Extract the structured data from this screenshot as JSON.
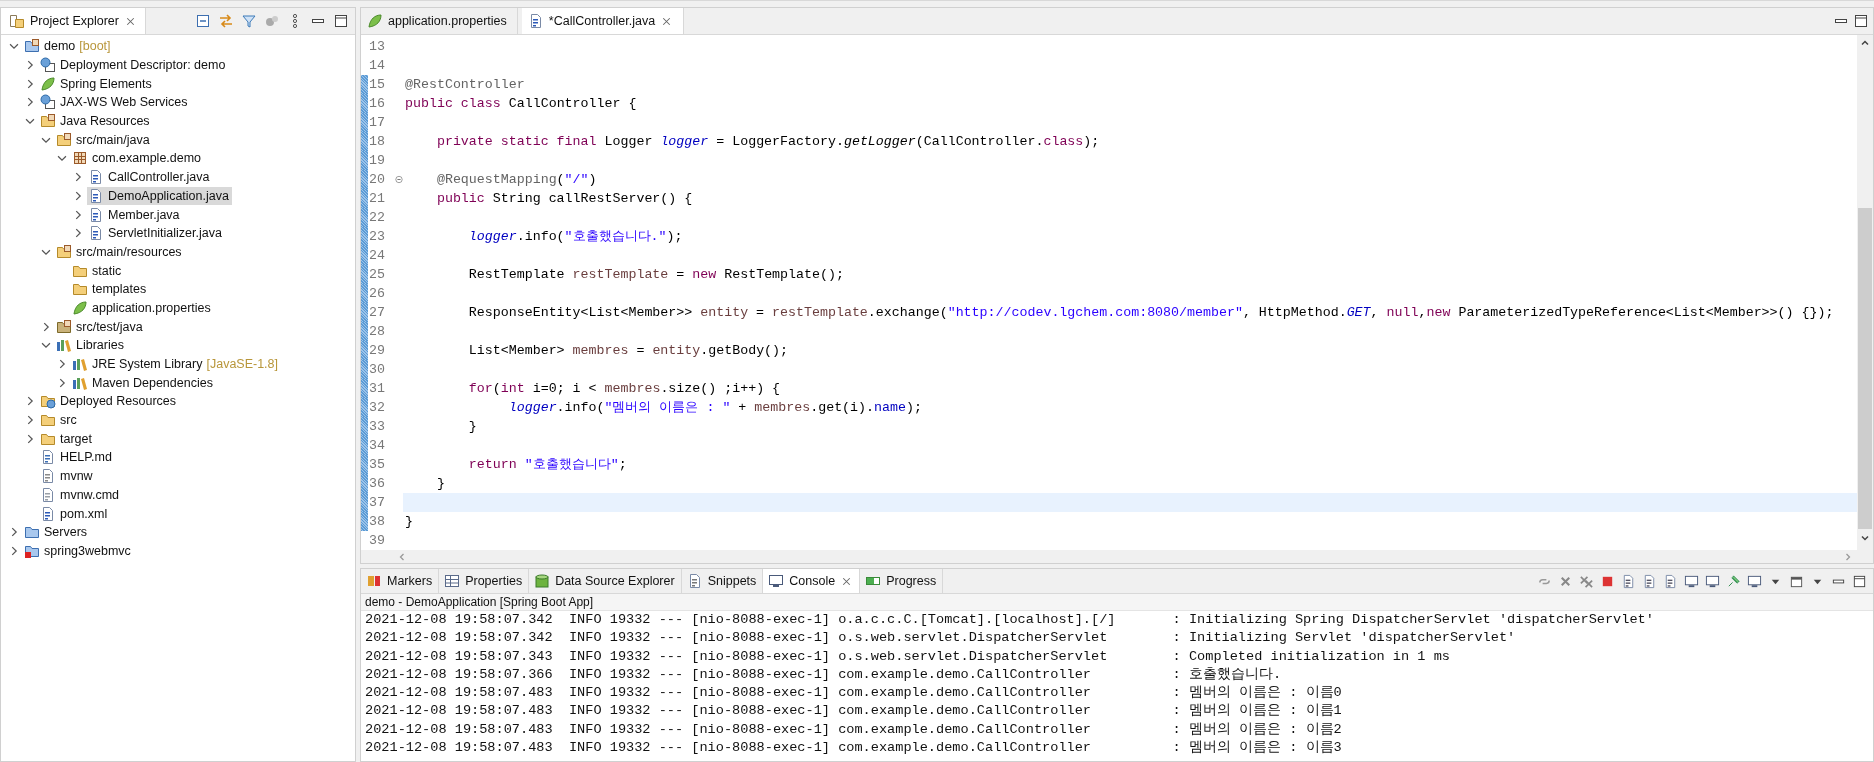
{
  "explorer": {
    "title": "Project Explorer",
    "tree": [
      {
        "label": "demo",
        "decoration": "[boot]",
        "kind": "boot-project",
        "expanded": true,
        "selected": false,
        "children": [
          {
            "label": "Deployment Descriptor: demo",
            "kind": "deployment-descriptor",
            "expanded": false,
            "selected": false
          },
          {
            "label": "Spring Elements",
            "kind": "spring-leaf",
            "expanded": false,
            "selected": false
          },
          {
            "label": "JAX-WS Web Services",
            "kind": "web-services",
            "expanded": false,
            "selected": false
          },
          {
            "label": "Java Resources",
            "kind": "java-resources",
            "expanded": true,
            "selected": false,
            "children": [
              {
                "label": "src/main/java",
                "kind": "source-folder",
                "expanded": true,
                "selected": false,
                "children": [
                  {
                    "label": "com.example.demo",
                    "kind": "package",
                    "expanded": true,
                    "selected": false,
                    "children": [
                      {
                        "label": "CallController.java",
                        "kind": "java-file",
                        "expanded": false,
                        "selected": false
                      },
                      {
                        "label": "DemoApplication.java",
                        "kind": "java-file",
                        "expanded": false,
                        "selected": true
                      },
                      {
                        "label": "Member.java",
                        "kind": "java-file",
                        "expanded": false,
                        "selected": false
                      },
                      {
                        "label": "ServletInitializer.java",
                        "kind": "java-file",
                        "expanded": false,
                        "selected": false
                      }
                    ]
                  }
                ]
              },
              {
                "label": "src/main/resources",
                "kind": "source-folder",
                "expanded": true,
                "selected": false,
                "children": [
                  {
                    "label": "static",
                    "kind": "folder",
                    "selected": false
                  },
                  {
                    "label": "templates",
                    "kind": "folder",
                    "selected": false
                  },
                  {
                    "label": "application.properties",
                    "kind": "spring-leaf",
                    "selected": false
                  }
                ]
              },
              {
                "label": "src/test/java",
                "kind": "test-source-folder",
                "expanded": false,
                "selected": false
              },
              {
                "label": "Libraries",
                "kind": "libraries",
                "expanded": true,
                "selected": false,
                "children": [
                  {
                    "label": "JRE System Library",
                    "decoration": "[JavaSE-1.8]",
                    "kind": "libraries",
                    "expanded": false,
                    "selected": false
                  },
                  {
                    "label": "Maven Dependencies",
                    "kind": "libraries",
                    "expanded": false,
                    "selected": false
                  }
                ]
              }
            ]
          },
          {
            "label": "Deployed Resources",
            "kind": "deployed",
            "expanded": false,
            "selected": false
          },
          {
            "label": "src",
            "kind": "folder",
            "expanded": false,
            "selected": false
          },
          {
            "label": "target",
            "kind": "folder",
            "expanded": false,
            "selected": false
          },
          {
            "label": "HELP.md",
            "kind": "markdown",
            "selected": false
          },
          {
            "label": "mvnw",
            "kind": "text-file",
            "selected": false
          },
          {
            "label": "mvnw.cmd",
            "kind": "cmd-file",
            "selected": false
          },
          {
            "label": "pom.xml",
            "kind": "maven-file",
            "selected": false
          }
        ]
      },
      {
        "label": "Servers",
        "kind": "servers",
        "expanded": false,
        "selected": false
      },
      {
        "label": "spring3webmvc",
        "kind": "error-project",
        "expanded": false,
        "selected": false
      }
    ]
  },
  "editor": {
    "tabs": [
      {
        "label": "application.properties",
        "kind": "spring-leaf",
        "selected": false
      },
      {
        "label": "*CallController.java",
        "kind": "java-file",
        "selected": true
      }
    ],
    "lines": [
      {
        "number": "13",
        "changed": false,
        "current": false,
        "foldable": false
      },
      {
        "number": "14",
        "changed": false,
        "current": false,
        "foldable": false
      },
      {
        "number": "15",
        "changed": true,
        "current": false,
        "foldable": false,
        "tokens": [
          {
            "kind": "annotation",
            "text": "@RestController"
          }
        ]
      },
      {
        "number": "16",
        "changed": true,
        "current": false,
        "foldable": false,
        "tokens": [
          {
            "kind": "keyword",
            "text": "public"
          },
          {
            "kind": "keyword",
            "text": " class"
          },
          {
            "kind": "plain",
            "text": " CallController {"
          }
        ]
      },
      {
        "number": "17",
        "changed": true,
        "current": false,
        "foldable": false
      },
      {
        "number": "18",
        "changed": true,
        "current": false,
        "foldable": false,
        "tokens": [
          {
            "kind": "keyword",
            "text": "    private"
          },
          {
            "kind": "keyword",
            "text": " static"
          },
          {
            "kind": "keyword",
            "text": " final"
          },
          {
            "kind": "plain",
            "text": " Logger "
          },
          {
            "kind": "static-field",
            "text": "logger"
          },
          {
            "kind": "plain",
            "text": " = LoggerFactory."
          },
          {
            "kind": "static-method",
            "text": "getLogger"
          },
          {
            "kind": "plain",
            "text": "(CallController."
          },
          {
            "kind": "keyword",
            "text": "class"
          },
          {
            "kind": "plain",
            "text": ");"
          }
        ]
      },
      {
        "number": "19",
        "changed": true,
        "current": false,
        "foldable": false
      },
      {
        "number": "20",
        "changed": true,
        "current": false,
        "foldable": true,
        "tokens": [
          {
            "kind": "annotation",
            "text": "    @RequestMapping"
          },
          {
            "kind": "plain",
            "text": "("
          },
          {
            "kind": "string",
            "text": "\"/\""
          },
          {
            "kind": "plain",
            "text": ")"
          }
        ]
      },
      {
        "number": "21",
        "changed": true,
        "current": false,
        "foldable": false,
        "tokens": [
          {
            "kind": "keyword",
            "text": "    public"
          },
          {
            "kind": "plain",
            "text": " String callRestServer() {"
          }
        ]
      },
      {
        "number": "22",
        "changed": true,
        "current": false,
        "foldable": false
      },
      {
        "number": "23",
        "changed": true,
        "current": false,
        "foldable": false,
        "tokens": [
          {
            "kind": "static-field",
            "text": "        logger"
          },
          {
            "kind": "plain",
            "text": ".info("
          },
          {
            "kind": "string",
            "text": "\"호출했습니다.\""
          },
          {
            "kind": "plain",
            "text": ");"
          }
        ]
      },
      {
        "number": "24",
        "changed": true,
        "current": false,
        "foldable": false
      },
      {
        "number": "25",
        "changed": true,
        "current": false,
        "foldable": false,
        "tokens": [
          {
            "kind": "plain",
            "text": "        RestTemplate "
          },
          {
            "kind": "local",
            "text": "restTemplate"
          },
          {
            "kind": "plain",
            "text": " = "
          },
          {
            "kind": "keyword",
            "text": "new"
          },
          {
            "kind": "plain",
            "text": " RestTemplate();"
          }
        ]
      },
      {
        "number": "26",
        "changed": true,
        "current": false,
        "foldable": false
      },
      {
        "number": "27",
        "changed": true,
        "current": false,
        "foldable": false,
        "tokens": [
          {
            "kind": "plain",
            "text": "        ResponseEntity<List<Member>> "
          },
          {
            "kind": "local",
            "text": "entity"
          },
          {
            "kind": "plain",
            "text": " = "
          },
          {
            "kind": "local",
            "text": "restTemplate"
          },
          {
            "kind": "plain",
            "text": ".exchange("
          },
          {
            "kind": "string",
            "text": "\"http://codev.lgchem.com:8080/member\""
          },
          {
            "kind": "plain",
            "text": ", HttpMethod."
          },
          {
            "kind": "static-field",
            "text": "GET"
          },
          {
            "kind": "plain",
            "text": ", "
          },
          {
            "kind": "keyword",
            "text": "null"
          },
          {
            "kind": "plain",
            "text": ","
          },
          {
            "kind": "keyword",
            "text": "new"
          },
          {
            "kind": "plain",
            "text": " ParameterizedTypeReference<List<Member>>() {});"
          }
        ]
      },
      {
        "number": "28",
        "changed": true,
        "current": false,
        "foldable": false
      },
      {
        "number": "29",
        "changed": true,
        "current": false,
        "foldable": false,
        "tokens": [
          {
            "kind": "plain",
            "text": "        List<Member> "
          },
          {
            "kind": "local",
            "text": "membres"
          },
          {
            "kind": "plain",
            "text": " = "
          },
          {
            "kind": "local",
            "text": "entity"
          },
          {
            "kind": "plain",
            "text": ".getBody();"
          }
        ]
      },
      {
        "number": "30",
        "changed": true,
        "current": false,
        "foldable": false
      },
      {
        "number": "31",
        "changed": true,
        "current": false,
        "foldable": false,
        "tokens": [
          {
            "kind": "keyword",
            "text": "        for"
          },
          {
            "kind": "plain",
            "text": "("
          },
          {
            "kind": "keyword",
            "text": "int"
          },
          {
            "kind": "plain",
            "text": " i=0; i < "
          },
          {
            "kind": "local",
            "text": "membres"
          },
          {
            "kind": "plain",
            "text": ".size() ;i++) {"
          }
        ]
      },
      {
        "number": "32",
        "changed": true,
        "current": false,
        "foldable": false,
        "tokens": [
          {
            "kind": "static-field",
            "text": "             logger"
          },
          {
            "kind": "plain",
            "text": ".info("
          },
          {
            "kind": "string",
            "text": "\"멤버의 이름은 : \""
          },
          {
            "kind": "plain",
            "text": " + "
          },
          {
            "kind": "local",
            "text": "membres"
          },
          {
            "kind": "plain",
            "text": ".get(i)."
          },
          {
            "kind": "field",
            "text": "name"
          },
          {
            "kind": "plain",
            "text": ");"
          }
        ]
      },
      {
        "number": "33",
        "changed": true,
        "current": false,
        "foldable": false,
        "tokens": [
          {
            "kind": "plain",
            "text": "        }"
          }
        ]
      },
      {
        "number": "34",
        "changed": true,
        "current": false,
        "foldable": false
      },
      {
        "number": "35",
        "changed": true,
        "current": false,
        "foldable": false,
        "tokens": [
          {
            "kind": "keyword",
            "text": "        return"
          },
          {
            "kind": "string",
            "text": " \"호출했습니다\""
          },
          {
            "kind": "plain",
            "text": ";"
          }
        ]
      },
      {
        "number": "36",
        "changed": true,
        "current": false,
        "foldable": false,
        "tokens": [
          {
            "kind": "plain",
            "text": "    }"
          }
        ]
      },
      {
        "number": "37",
        "changed": true,
        "current": true,
        "foldable": false
      },
      {
        "number": "38",
        "changed": true,
        "current": false,
        "foldable": false,
        "tokens": [
          {
            "kind": "plain",
            "text": "}"
          }
        ]
      },
      {
        "number": "39",
        "changed": false,
        "current": false,
        "foldable": false
      }
    ]
  },
  "console": {
    "tabs": [
      {
        "label": "Markers",
        "kind": "markers",
        "selected": false
      },
      {
        "label": "Properties",
        "kind": "properties",
        "selected": false
      },
      {
        "label": "Data Source Explorer",
        "kind": "data-source",
        "selected": false
      },
      {
        "label": "Snippets",
        "kind": "snippets",
        "selected": false
      },
      {
        "label": "Console",
        "kind": "console",
        "selected": true
      },
      {
        "label": "Progress",
        "kind": "progress",
        "selected": false
      }
    ],
    "process": "demo - DemoApplication [Spring Boot App]",
    "output": [
      "2021-12-08 19:58:07.342  INFO 19332 --- [nio-8088-exec-1] o.a.c.c.C.[Tomcat].[localhost].[/]       : Initializing Spring DispatcherServlet 'dispatcherServlet'",
      "2021-12-08 19:58:07.342  INFO 19332 --- [nio-8088-exec-1] o.s.web.servlet.DispatcherServlet        : Initializing Servlet 'dispatcherServlet'",
      "2021-12-08 19:58:07.343  INFO 19332 --- [nio-8088-exec-1] o.s.web.servlet.DispatcherServlet        : Completed initialization in 1 ms",
      "2021-12-08 19:58:07.366  INFO 19332 --- [nio-8088-exec-1] com.example.demo.CallController          : 호출했습니다.",
      "2021-12-08 19:58:07.483  INFO 19332 --- [nio-8088-exec-1] com.example.demo.CallController          : 멤버의 이름은 : 이름0",
      "2021-12-08 19:58:07.483  INFO 19332 --- [nio-8088-exec-1] com.example.demo.CallController          : 멤버의 이름은 : 이름1",
      "2021-12-08 19:58:07.483  INFO 19332 --- [nio-8088-exec-1] com.example.demo.CallController          : 멤버의 이름은 : 이름2",
      "2021-12-08 19:58:07.483  INFO 19332 --- [nio-8088-exec-1] com.example.demo.CallController          : 멤버의 이름은 : 이름3"
    ]
  }
}
